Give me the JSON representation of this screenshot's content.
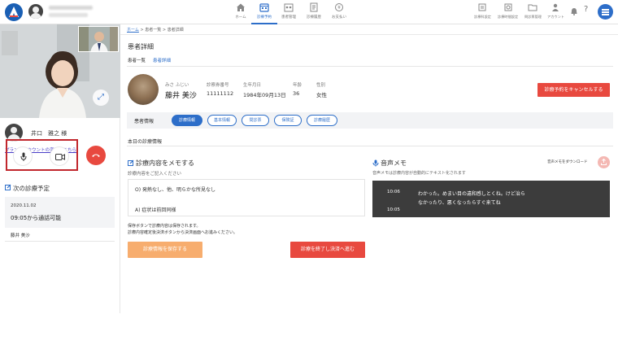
{
  "header": {
    "nav": [
      {
        "label": "ホーム",
        "icon": "home-icon"
      },
      {
        "label": "診療予約",
        "icon": "calendar-icon",
        "active": true
      },
      {
        "label": "患者管理",
        "icon": "patients-icon"
      },
      {
        "label": "診療履歴",
        "icon": "history-icon"
      },
      {
        "label": "お支払い",
        "icon": "payment-icon"
      }
    ],
    "right_nav": [
      {
        "label": "診療科設定",
        "icon": "department-icon"
      },
      {
        "label": "診療時間設定",
        "icon": "clock-settings-icon"
      },
      {
        "label": "問診票管理",
        "icon": "folder-icon"
      },
      {
        "label": "アカウント",
        "icon": "account-icon"
      }
    ]
  },
  "left": {
    "user_name": "井口　雅之 様",
    "plan_link": "プラン・アカウントの変更はこちら",
    "next_title": "次の診療予定",
    "next_date": "2020.11.02",
    "next_time": "09:05から通話可能",
    "next_patient": "藤井 美沙"
  },
  "main": {
    "breadcrumb": {
      "home": "ホーム",
      "sep1": " > ",
      "list": "患者一覧",
      "sep2": " > ",
      "current": "患者詳細"
    },
    "page_title": "患者詳細",
    "subtabs": [
      "患者一覧",
      "患者詳細"
    ],
    "patient": {
      "kana": "みさ ふじい",
      "name": "藤井 美沙",
      "id_label": "診察券番号",
      "id": "11111112",
      "birth_label": "生年月日",
      "birth": "1984年09月13日",
      "age_label": "年齢",
      "age": "36",
      "sex_label": "性別",
      "sex": "女性"
    },
    "cancel_button": "診療予約をキャンセルする",
    "info_label": "患者情報",
    "pills": [
      "診療情報",
      "基本情報",
      "問診票",
      "保険証",
      "診療履歴"
    ],
    "today_label": "本日の診療情報",
    "memo": {
      "title": "診療内容をメモする",
      "subtitle": "診療内容をご記入ください",
      "line1": "O) 発熱なし、他、明らかな所見なし",
      "line2": "A) 症状は前回同様",
      "note1": "保存ボタンで診療内容は保存されます。",
      "note2": "診療内容確定後決済ボタンから決済画面へお進みください。",
      "save_button": "診療情報を保存する",
      "finish_button": "診療を終了し決済へ進む"
    },
    "voice": {
      "title": "音声メモ",
      "subtitle": "音声メモは診療内容が自動的にテキスト化されます",
      "download": "音声メモをダウンロード",
      "entries": [
        {
          "time": "10:06",
          "text": "わかった。めまい目の違和感しとくね。けど治ら"
        },
        {
          "time": "",
          "text": "なかったり、悪くなったらすぐ来てね"
        },
        {
          "time": "10:05",
          "text": ""
        }
      ]
    }
  },
  "colors": {
    "accent": "#2d6ec9",
    "danger": "#e8493f",
    "warning": "#f7ad6e",
    "highlight_box": "#c1272d"
  }
}
